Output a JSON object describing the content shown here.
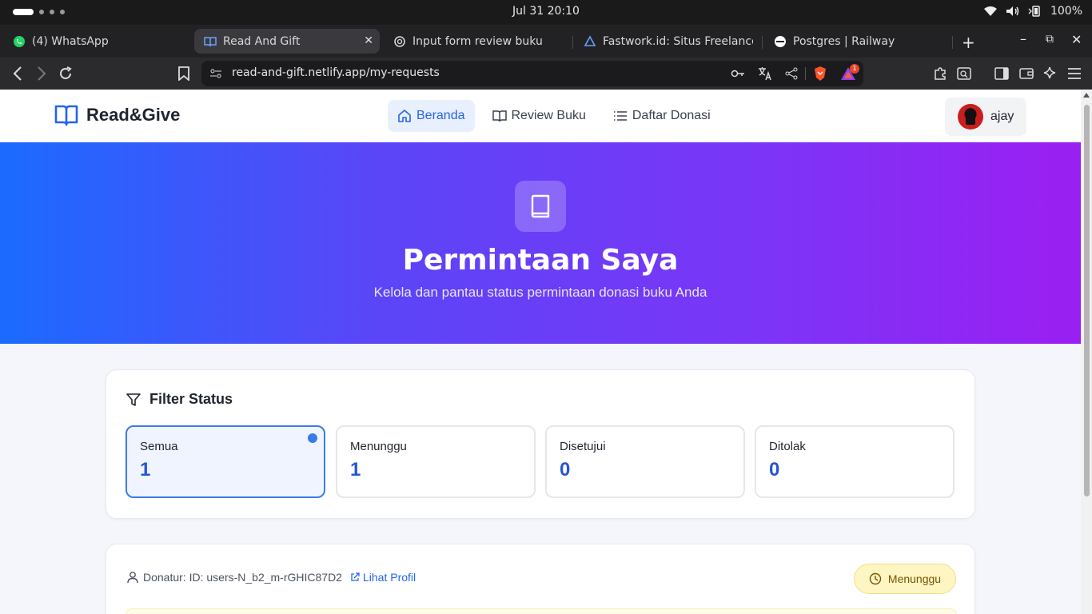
{
  "os": {
    "clock": "Jul 31  20:10",
    "battery": "100%"
  },
  "browser": {
    "tabs": [
      {
        "label": "(4) WhatsApp",
        "icon": "whatsapp-icon"
      },
      {
        "label": "Read And Gift",
        "icon": "book-icon"
      },
      {
        "label": "Input form review buku",
        "icon": "openai-icon"
      },
      {
        "label": "Fastwork.id: Situs Freelance",
        "icon": "fastwork-icon"
      },
      {
        "label": "Postgres | Railway",
        "icon": "railway-icon"
      }
    ],
    "url": "read-and-gift.netlify.app/my-requests",
    "notification_count": "1"
  },
  "site": {
    "brand": "Read&Give",
    "nav": [
      {
        "label": "Beranda",
        "icon": "home-icon"
      },
      {
        "label": "Review Buku",
        "icon": "book-open-icon"
      },
      {
        "label": "Daftar Donasi",
        "icon": "list-icon"
      }
    ],
    "user": "ajay"
  },
  "hero": {
    "title": "Permintaan Saya",
    "subtitle": "Kelola dan pantau status permintaan donasi buku Anda"
  },
  "filter": {
    "title": "Filter Status",
    "statuses": [
      {
        "label": "Semua",
        "count": "1"
      },
      {
        "label": "Menunggu",
        "count": "1"
      },
      {
        "label": "Disetujui",
        "count": "0"
      },
      {
        "label": "Ditolak",
        "count": "0"
      }
    ]
  },
  "request": {
    "donor": "Donatur: ID: users-N_b2_m-rGHIC87D2",
    "profile_link": "Lihat Profil",
    "status": "Menunggu"
  },
  "colors": {
    "accent": "#2563eb",
    "hero_start": "#1b6bff",
    "hero_end": "#9b1ff2",
    "pending_bg": "#fdf6c3"
  }
}
